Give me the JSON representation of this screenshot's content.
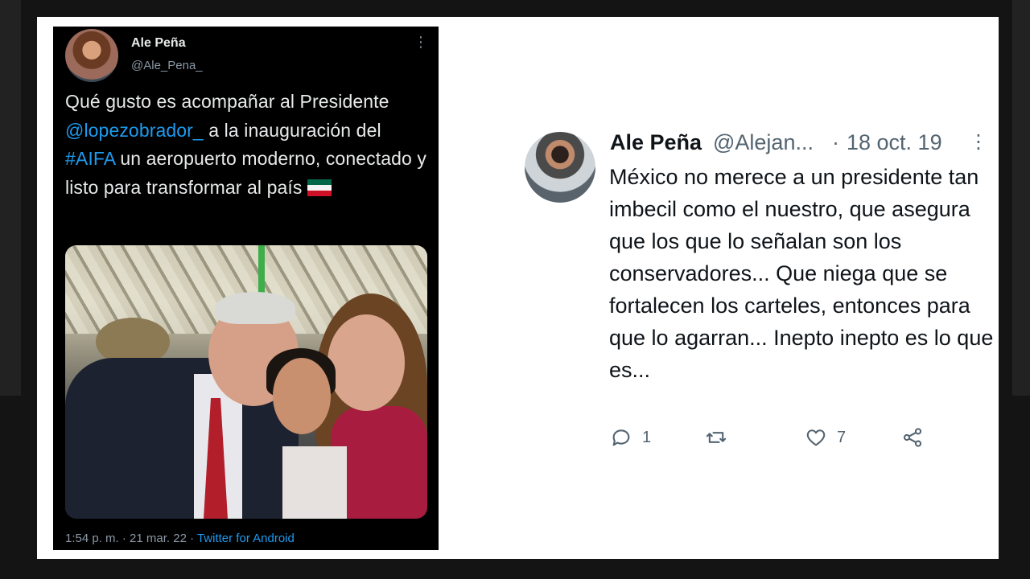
{
  "left_tweet": {
    "name": "Ale Peña",
    "handle": "@Ale_Pena_",
    "more": "⋮",
    "text_before": "Qué gusto es acompañar al Presidente ",
    "mention": "@lopezobrador_",
    "text_middle": " a la inauguración del ",
    "hashtag": "#AIFA",
    "text_after": " un aeropuerto moderno, conectado y listo para transformar al país ",
    "flag_icon": "mexico-flag-icon",
    "time_date": "1:54 p. m. · 21 mar. 22 · ",
    "source": "Twitter for Android"
  },
  "right_tweet": {
    "name": "Ale Peña",
    "handle": "@Alejan...",
    "separator": "·",
    "date": "18 oct. 19",
    "more": "⋮",
    "text": "México no merece a un presidente tan imbecil como el nuestro, que asegura que los que lo señalan son los conservadores... Que niega que se fortalecen los carteles, entonces para que lo agarran... Inepto inepto es lo que es...",
    "actions": {
      "reply_count": "1",
      "retweet_count": "",
      "like_count": "7"
    }
  },
  "colors": {
    "link_blue": "#1d9bf0",
    "muted_gray": "#536471",
    "dark_bg": "#000000"
  }
}
